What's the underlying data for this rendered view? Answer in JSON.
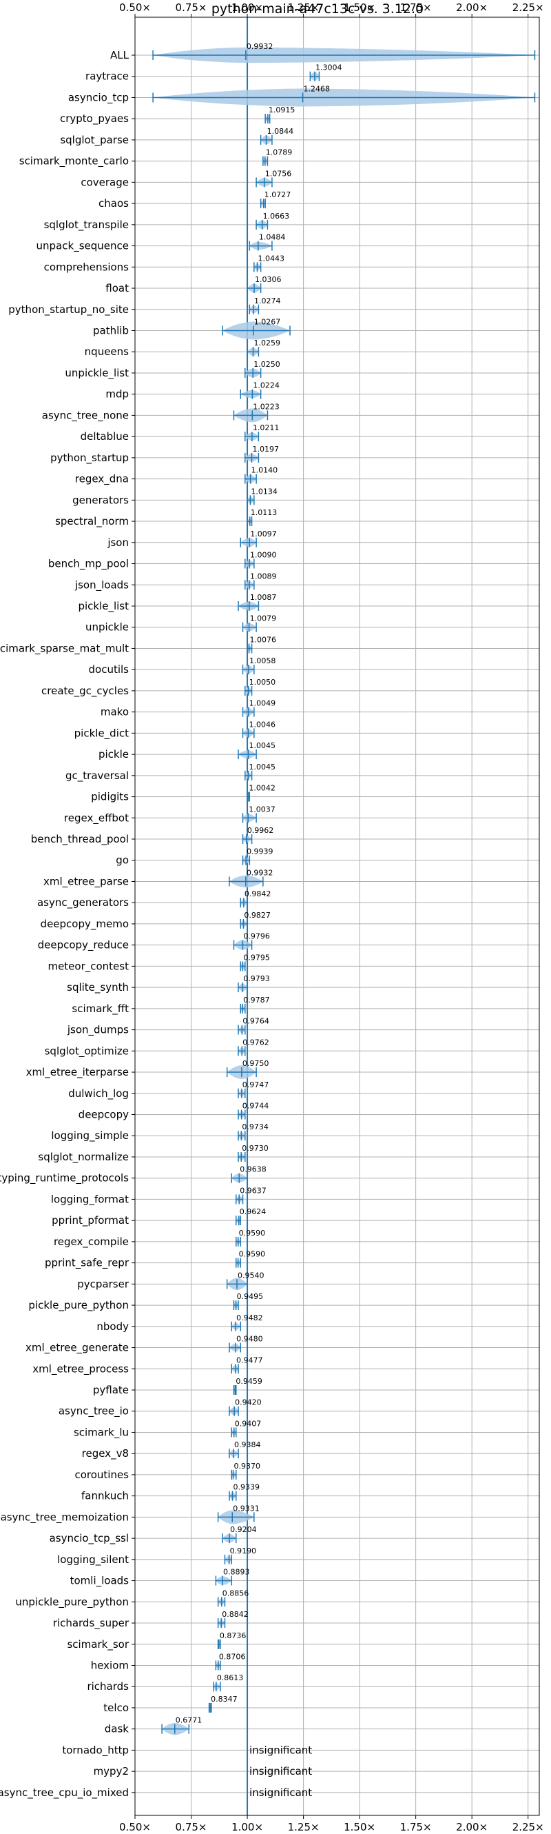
{
  "chart_data": {
    "type": "violin",
    "title": "python-main-a47c13c vs. 3.12.0",
    "xlabel": "",
    "ylabel": "",
    "xlim": [
      0.5,
      2.3
    ],
    "x_ticks": [
      {
        "value": 0.5,
        "label": "0.50×"
      },
      {
        "value": 0.75,
        "label": "0.75×"
      },
      {
        "value": 1.0,
        "label": "1.00×"
      },
      {
        "value": 1.25,
        "label": "1.25×"
      },
      {
        "value": 1.5,
        "label": "1.50×"
      },
      {
        "value": 1.75,
        "label": "1.75×"
      },
      {
        "value": 2.0,
        "label": "2.00×"
      },
      {
        "value": 2.25,
        "label": "2.25×"
      }
    ],
    "grid": true,
    "reference_line": 1.0,
    "colors": {
      "accent": "#1f77b4",
      "violin": "#a9c9e6",
      "grid": "#b0b0b0"
    },
    "benchmarks": [
      {
        "name": "ALL",
        "value": 0.9932,
        "label": "0.9932",
        "min": 0.58,
        "max": 2.28,
        "spread": 0.06
      },
      {
        "name": "raytrace",
        "value": 1.3004,
        "label": "1.3004",
        "min": 1.28,
        "max": 1.32,
        "spread": 0.02
      },
      {
        "name": "asyncio_tcp",
        "value": 1.2468,
        "label": "1.2468",
        "min": 0.58,
        "max": 2.28,
        "spread": 0.65
      },
      {
        "name": "crypto_pyaes",
        "value": 1.0915,
        "label": "1.0915",
        "min": 1.08,
        "max": 1.1,
        "spread": 0.01
      },
      {
        "name": "sqlglot_parse",
        "value": 1.0844,
        "label": "1.0844",
        "min": 1.06,
        "max": 1.11,
        "spread": 0.02
      },
      {
        "name": "scimark_monte_carlo",
        "value": 1.0789,
        "label": "1.0789",
        "min": 1.07,
        "max": 1.09,
        "spread": 0.01
      },
      {
        "name": "coverage",
        "value": 1.0756,
        "label": "1.0756",
        "min": 1.04,
        "max": 1.11,
        "spread": 0.02
      },
      {
        "name": "chaos",
        "value": 1.0727,
        "label": "1.0727",
        "min": 1.06,
        "max": 1.08,
        "spread": 0.01
      },
      {
        "name": "sqlglot_transpile",
        "value": 1.0663,
        "label": "1.0663",
        "min": 1.04,
        "max": 1.09,
        "spread": 0.02
      },
      {
        "name": "unpack_sequence",
        "value": 1.0484,
        "label": "1.0484",
        "min": 1.01,
        "max": 1.11,
        "spread": 0.015
      },
      {
        "name": "comprehensions",
        "value": 1.0443,
        "label": "1.0443",
        "min": 1.03,
        "max": 1.06,
        "spread": 0.01
      },
      {
        "name": "float",
        "value": 1.0306,
        "label": "1.0306",
        "min": 1.0,
        "max": 1.06,
        "spread": 0.02
      },
      {
        "name": "python_startup_no_site",
        "value": 1.0274,
        "label": "1.0274",
        "min": 1.01,
        "max": 1.05,
        "spread": 0.015
      },
      {
        "name": "pathlib",
        "value": 1.0267,
        "label": "1.0267",
        "min": 0.89,
        "max": 1.19,
        "spread": 0.09
      },
      {
        "name": "nqueens",
        "value": 1.0259,
        "label": "1.0259",
        "min": 1.0,
        "max": 1.05,
        "spread": 0.015
      },
      {
        "name": "unpickle_list",
        "value": 1.025,
        "label": "1.0250",
        "min": 0.99,
        "max": 1.06,
        "spread": 0.02
      },
      {
        "name": "mdp",
        "value": 1.0224,
        "label": "1.0224",
        "min": 0.97,
        "max": 1.06,
        "spread": 0.015
      },
      {
        "name": "async_tree_none",
        "value": 1.0223,
        "label": "1.0223",
        "min": 0.94,
        "max": 1.09,
        "spread": 0.05
      },
      {
        "name": "deltablue",
        "value": 1.0211,
        "label": "1.0211",
        "min": 0.99,
        "max": 1.05,
        "spread": 0.015
      },
      {
        "name": "python_startup",
        "value": 1.0197,
        "label": "1.0197",
        "min": 0.99,
        "max": 1.05,
        "spread": 0.015
      },
      {
        "name": "regex_dna",
        "value": 1.014,
        "label": "1.0140",
        "min": 0.99,
        "max": 1.04,
        "spread": 0.015
      },
      {
        "name": "generators",
        "value": 1.0134,
        "label": "1.0134",
        "min": 1.0,
        "max": 1.03,
        "spread": 0.01
      },
      {
        "name": "spectral_norm",
        "value": 1.0113,
        "label": "1.0113",
        "min": 1.0,
        "max": 1.02,
        "spread": 0.005
      },
      {
        "name": "json",
        "value": 1.0097,
        "label": "1.0097",
        "min": 0.97,
        "max": 1.04,
        "spread": 0.02
      },
      {
        "name": "bench_mp_pool",
        "value": 1.009,
        "label": "1.0090",
        "min": 0.99,
        "max": 1.03,
        "spread": 0.01
      },
      {
        "name": "json_loads",
        "value": 1.0089,
        "label": "1.0089",
        "min": 0.99,
        "max": 1.03,
        "spread": 0.01
      },
      {
        "name": "pickle_list",
        "value": 1.0087,
        "label": "1.0087",
        "min": 0.96,
        "max": 1.05,
        "spread": 0.02
      },
      {
        "name": "unpickle",
        "value": 1.0079,
        "label": "1.0079",
        "min": 0.98,
        "max": 1.04,
        "spread": 0.015
      },
      {
        "name": "scimark_sparse_mat_mult",
        "value": 1.0076,
        "label": "1.0076",
        "min": 1.0,
        "max": 1.02,
        "spread": 0.005
      },
      {
        "name": "docutils",
        "value": 1.0058,
        "label": "1.0058",
        "min": 0.98,
        "max": 1.03,
        "spread": 0.015
      },
      {
        "name": "create_gc_cycles",
        "value": 1.005,
        "label": "1.0050",
        "min": 0.99,
        "max": 1.02,
        "spread": 0.01
      },
      {
        "name": "mako",
        "value": 1.0049,
        "label": "1.0049",
        "min": 0.98,
        "max": 1.03,
        "spread": 0.015
      },
      {
        "name": "pickle_dict",
        "value": 1.0046,
        "label": "1.0046",
        "min": 0.98,
        "max": 1.03,
        "spread": 0.015
      },
      {
        "name": "pickle",
        "value": 1.0045,
        "label": "1.0045",
        "min": 0.96,
        "max": 1.04,
        "spread": 0.015
      },
      {
        "name": "gc_traversal",
        "value": 1.0045,
        "label": "1.0045",
        "min": 0.99,
        "max": 1.02,
        "spread": 0.005
      },
      {
        "name": "pidigits",
        "value": 1.0042,
        "label": "1.0042",
        "min": 1.0,
        "max": 1.01,
        "spread": 0.003
      },
      {
        "name": "regex_effbot",
        "value": 1.0037,
        "label": "1.0037",
        "min": 0.98,
        "max": 1.04,
        "spread": 0.015
      },
      {
        "name": "bench_thread_pool",
        "value": 0.9962,
        "label": "0.9962",
        "min": 0.98,
        "max": 1.02,
        "spread": 0.01
      },
      {
        "name": "go",
        "value": 0.9939,
        "label": "0.9939",
        "min": 0.98,
        "max": 1.01,
        "spread": 0.01
      },
      {
        "name": "xml_etree_parse",
        "value": 0.9932,
        "label": "0.9932",
        "min": 0.92,
        "max": 1.07,
        "spread": 0.04
      },
      {
        "name": "async_generators",
        "value": 0.9842,
        "label": "0.9842",
        "min": 0.97,
        "max": 1.0,
        "spread": 0.01
      },
      {
        "name": "deepcopy_memo",
        "value": 0.9827,
        "label": "0.9827",
        "min": 0.97,
        "max": 1.0,
        "spread": 0.01
      },
      {
        "name": "deepcopy_reduce",
        "value": 0.9796,
        "label": "0.9796",
        "min": 0.94,
        "max": 1.02,
        "spread": 0.025
      },
      {
        "name": "meteor_contest",
        "value": 0.9795,
        "label": "0.9795",
        "min": 0.97,
        "max": 0.99,
        "spread": 0.01
      },
      {
        "name": "sqlite_synth",
        "value": 0.9793,
        "label": "0.9793",
        "min": 0.96,
        "max": 1.0,
        "spread": 0.015
      },
      {
        "name": "scimark_fft",
        "value": 0.9787,
        "label": "0.9787",
        "min": 0.97,
        "max": 0.99,
        "spread": 0.005
      },
      {
        "name": "json_dumps",
        "value": 0.9764,
        "label": "0.9764",
        "min": 0.96,
        "max": 0.99,
        "spread": 0.01
      },
      {
        "name": "sqlglot_optimize",
        "value": 0.9762,
        "label": "0.9762",
        "min": 0.96,
        "max": 0.99,
        "spread": 0.01
      },
      {
        "name": "xml_etree_iterparse",
        "value": 0.975,
        "label": "0.9750",
        "min": 0.91,
        "max": 1.04,
        "spread": 0.05
      },
      {
        "name": "dulwich_log",
        "value": 0.9747,
        "label": "0.9747",
        "min": 0.96,
        "max": 0.99,
        "spread": 0.01
      },
      {
        "name": "deepcopy",
        "value": 0.9744,
        "label": "0.9744",
        "min": 0.96,
        "max": 0.99,
        "spread": 0.01
      },
      {
        "name": "logging_simple",
        "value": 0.9734,
        "label": "0.9734",
        "min": 0.96,
        "max": 0.99,
        "spread": 0.01
      },
      {
        "name": "sqlglot_normalize",
        "value": 0.973,
        "label": "0.9730",
        "min": 0.96,
        "max": 0.99,
        "spread": 0.01
      },
      {
        "name": "typing_runtime_protocols",
        "value": 0.9638,
        "label": "0.9638",
        "min": 0.93,
        "max": 1.0,
        "spread": 0.02
      },
      {
        "name": "logging_format",
        "value": 0.9637,
        "label": "0.9637",
        "min": 0.95,
        "max": 0.98,
        "spread": 0.01
      },
      {
        "name": "pprint_pformat",
        "value": 0.9624,
        "label": "0.9624",
        "min": 0.95,
        "max": 0.97,
        "spread": 0.005
      },
      {
        "name": "regex_compile",
        "value": 0.959,
        "label": "0.9590",
        "min": 0.95,
        "max": 0.97,
        "spread": 0.005
      },
      {
        "name": "pprint_safe_repr",
        "value": 0.959,
        "label": "0.9590",
        "min": 0.95,
        "max": 0.97,
        "spread": 0.005
      },
      {
        "name": "pycparser",
        "value": 0.954,
        "label": "0.9540",
        "min": 0.91,
        "max": 1.0,
        "spread": 0.04
      },
      {
        "name": "pickle_pure_python",
        "value": 0.9495,
        "label": "0.9495",
        "min": 0.94,
        "max": 0.96,
        "spread": 0.01
      },
      {
        "name": "nbody",
        "value": 0.9482,
        "label": "0.9482",
        "min": 0.93,
        "max": 0.97,
        "spread": 0.01
      },
      {
        "name": "xml_etree_generate",
        "value": 0.948,
        "label": "0.9480",
        "min": 0.92,
        "max": 0.97,
        "spread": 0.015
      },
      {
        "name": "xml_etree_process",
        "value": 0.9477,
        "label": "0.9477",
        "min": 0.93,
        "max": 0.96,
        "spread": 0.01
      },
      {
        "name": "pyflate",
        "value": 0.9459,
        "label": "0.9459",
        "min": 0.94,
        "max": 0.95,
        "spread": 0.005
      },
      {
        "name": "async_tree_io",
        "value": 0.942,
        "label": "0.9420",
        "min": 0.92,
        "max": 0.96,
        "spread": 0.015
      },
      {
        "name": "scimark_lu",
        "value": 0.9407,
        "label": "0.9407",
        "min": 0.93,
        "max": 0.95,
        "spread": 0.005
      },
      {
        "name": "regex_v8",
        "value": 0.9384,
        "label": "0.9384",
        "min": 0.92,
        "max": 0.96,
        "spread": 0.01
      },
      {
        "name": "coroutines",
        "value": 0.937,
        "label": "0.9370",
        "min": 0.93,
        "max": 0.95,
        "spread": 0.005
      },
      {
        "name": "fannkuch",
        "value": 0.9339,
        "label": "0.9339",
        "min": 0.92,
        "max": 0.95,
        "spread": 0.01
      },
      {
        "name": "async_tree_memoization",
        "value": 0.9331,
        "label": "0.9331",
        "min": 0.87,
        "max": 1.03,
        "spread": 0.05
      },
      {
        "name": "asyncio_tcp_ssl",
        "value": 0.9204,
        "label": "0.9204",
        "min": 0.89,
        "max": 0.95,
        "spread": 0.02
      },
      {
        "name": "logging_silent",
        "value": 0.919,
        "label": "0.9190",
        "min": 0.9,
        "max": 0.93,
        "spread": 0.01
      },
      {
        "name": "tomli_loads",
        "value": 0.8893,
        "label": "0.8893",
        "min": 0.86,
        "max": 0.93,
        "spread": 0.02
      },
      {
        "name": "unpickle_pure_python",
        "value": 0.8856,
        "label": "0.8856",
        "min": 0.87,
        "max": 0.9,
        "spread": 0.01
      },
      {
        "name": "richards_super",
        "value": 0.8842,
        "label": "0.8842",
        "min": 0.87,
        "max": 0.9,
        "spread": 0.01
      },
      {
        "name": "scimark_sor",
        "value": 0.8736,
        "label": "0.8736",
        "min": 0.87,
        "max": 0.88,
        "spread": 0.005
      },
      {
        "name": "hexiom",
        "value": 0.8706,
        "label": "0.8706",
        "min": 0.86,
        "max": 0.88,
        "spread": 0.005
      },
      {
        "name": "richards",
        "value": 0.8613,
        "label": "0.8613",
        "min": 0.85,
        "max": 0.88,
        "spread": 0.01
      },
      {
        "name": "telco",
        "value": 0.8347,
        "label": "0.8347",
        "min": 0.83,
        "max": 0.84,
        "spread": 0.005
      },
      {
        "name": "dask",
        "value": 0.6771,
        "label": "0.6771",
        "min": 0.62,
        "max": 0.74,
        "spread": 0.04
      },
      {
        "name": "tornado_http",
        "value": null,
        "label": "insignificant"
      },
      {
        "name": "mypy2",
        "value": null,
        "label": "insignificant"
      },
      {
        "name": "async_tree_cpu_io_mixed",
        "value": null,
        "label": "insignificant"
      }
    ]
  }
}
